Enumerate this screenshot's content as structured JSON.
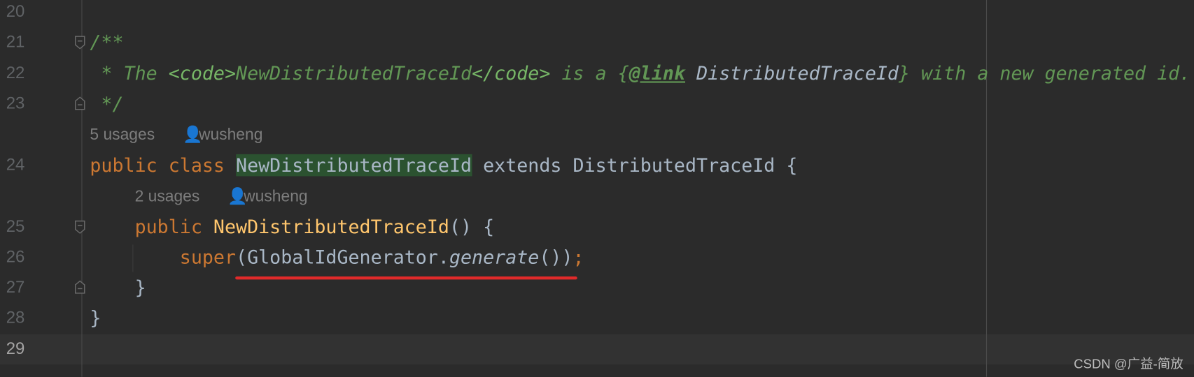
{
  "editor": {
    "lines": [
      {
        "number": "20"
      },
      {
        "number": "21",
        "code": "/**"
      },
      {
        "number": "22",
        "parts": [
          " * The ",
          "<code>",
          "NewDistributedTraceId",
          "</code>",
          " is a {",
          "@link",
          " ",
          "DistributedTraceId",
          "} with a new generated id."
        ]
      },
      {
        "number": "23",
        "code": " */"
      },
      {
        "number": "24",
        "parts": [
          "public class ",
          "NewDistributedTraceId",
          " extends DistributedTraceId {"
        ]
      },
      {
        "number": "25",
        "parts": [
          "    public ",
          "NewDistributedTraceId",
          "() {"
        ]
      },
      {
        "number": "26",
        "parts": [
          "        super",
          "(GlobalIdGenerator.",
          "generate",
          "())",
          ";"
        ]
      },
      {
        "number": "27",
        "code": "    }"
      },
      {
        "number": "28",
        "code": "}"
      },
      {
        "number": "29"
      }
    ],
    "hints": [
      {
        "usages": "5 usages",
        "author": "wusheng",
        "icon": "user-icon"
      },
      {
        "usages": "2 usages",
        "author": "wusheng",
        "icon": "user-icon"
      }
    ],
    "current_line": "29",
    "colors": {
      "background": "#2b2b2b",
      "keyword": "#cc7832",
      "comment": "#629755",
      "method": "#ffc66d",
      "identifier_highlight": "#2b5230",
      "annotation_underline": "#e02a2a"
    }
  },
  "watermark": "CSDN @广益-简放"
}
